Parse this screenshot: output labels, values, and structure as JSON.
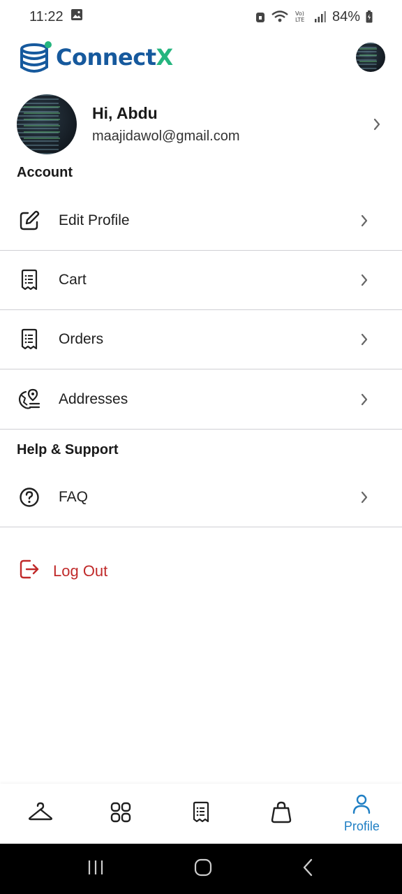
{
  "status_bar": {
    "time": "11:22",
    "battery": "84%",
    "network_label": "Vo) LTE"
  },
  "header": {
    "brand_part1": "Connect",
    "brand_part2": "X",
    "accent_blue": "#16599d",
    "accent_green": "#26b57f"
  },
  "profile": {
    "greeting": "Hi, Abdu",
    "email": "maajidawol@gmail.com"
  },
  "sections": {
    "account": "Account",
    "help": "Help & Support"
  },
  "menu": {
    "edit_profile": "Edit Profile",
    "cart": "Cart",
    "orders": "Orders",
    "addresses": "Addresses",
    "faq": "FAQ"
  },
  "logout": {
    "label": "Log Out",
    "color": "#c02a2a"
  },
  "bottom_nav": {
    "profile_label": "Profile",
    "active_color": "#1f7fc4"
  }
}
